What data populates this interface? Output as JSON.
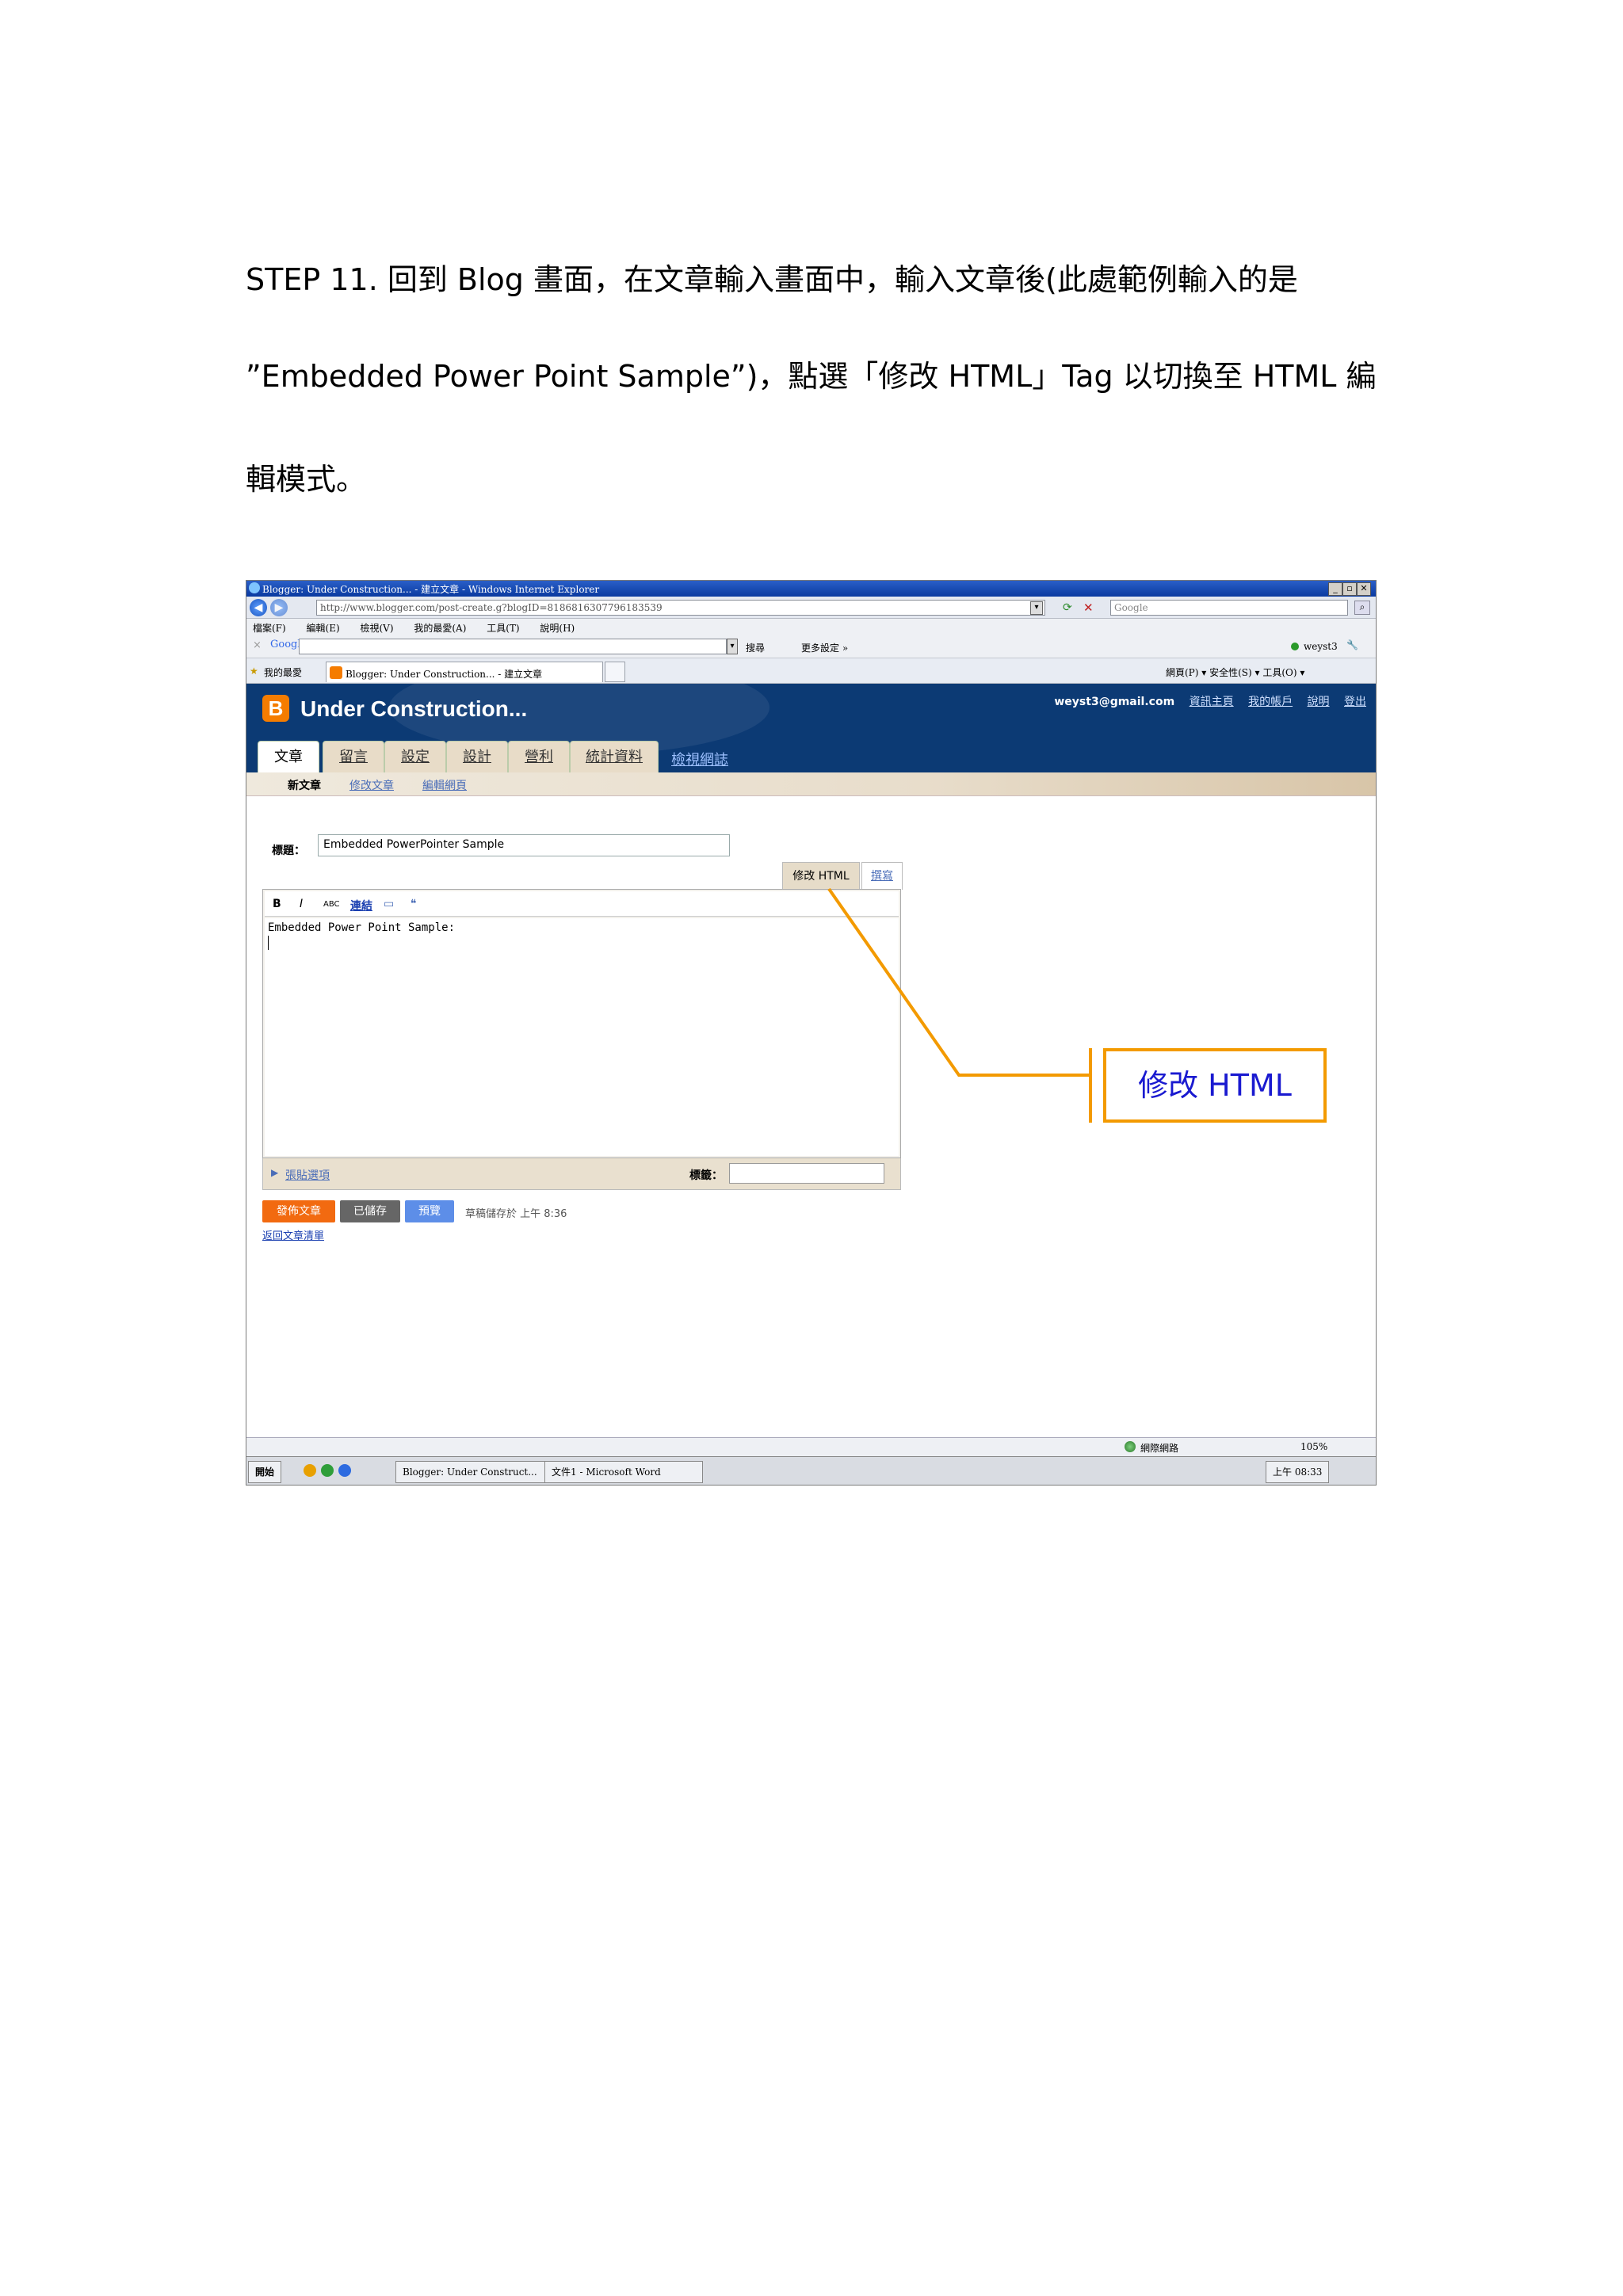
{
  "instructions": {
    "line1": "STEP 11. 回到 Blog 畫面，在文章輸入畫面中，輸入文章後(此處範例輸入的是",
    "line2": "”Embedded Power Point Sample”)，點選「修改 HTML」Tag 以切換至 HTML 編",
    "line3": "輯模式。"
  },
  "browser": {
    "window_title": "Blogger: Under Construction... - 建立文章 - Windows Internet Explorer",
    "address": "http://www.blogger.com/post-create.g?blogID=8186816307796183539",
    "search_placeholder": "Google",
    "menu": [
      "檔案(F)",
      "編輯(E)",
      "檢視(V)",
      "我的最愛(A)",
      "工具(T)",
      "說明(H)"
    ],
    "google_logo": "Google",
    "google_search": "搜尋",
    "google_more": "更多設定 »",
    "google_user": "weyst3",
    "favorites_label": "我的最愛",
    "tab_title": "Blogger: Under Construction... - 建立文章",
    "tab_tools": "網頁(P) ▾   安全性(S) ▾   工具(O) ▾"
  },
  "blogger": {
    "blog_title": "Under Construction...",
    "user_email": "weyst3@gmail.com",
    "user_links": [
      "資訊主頁",
      "我的帳戶",
      "說明",
      "登出"
    ],
    "main_tabs": [
      "文章",
      "留言",
      "設定",
      "設計",
      "營利",
      "統計資料"
    ],
    "view_blog": "檢視網誌",
    "sub_tabs": [
      "新文章",
      "修改文章",
      "編輯網頁"
    ],
    "title_label": "標題：",
    "title_value": "Embedded PowerPointer Sample",
    "edit_html_tab": "修改 HTML",
    "compose_tab": "撰寫",
    "toolbar": [
      "B",
      "I",
      "ABC",
      "連結",
      "▭",
      "❝"
    ],
    "post_body": "Embedded Power Point Sample:",
    "post_options": "張貼選項",
    "labels_label": "標籤：",
    "publish_button": "發佈文章",
    "saved_button": "已儲存",
    "preview_button": "預覽",
    "draft_status": "草稿儲存於 上午 8:36",
    "back_link": "返回文章清單"
  },
  "statusbar": {
    "zone": "網際網路",
    "zoom": "105%"
  },
  "taskbar": {
    "start": "開始",
    "items": [
      "Blogger: Under Construct...",
      "文件1 - Microsoft Word"
    ],
    "time": "上午 08:33"
  },
  "callout": "修改  HTML",
  "colors": {
    "callout_border": "#f39a00",
    "callout_text": "#1a1ad0",
    "blogger_header": "#0c3a74",
    "blogger_logo": "#f57c00"
  }
}
